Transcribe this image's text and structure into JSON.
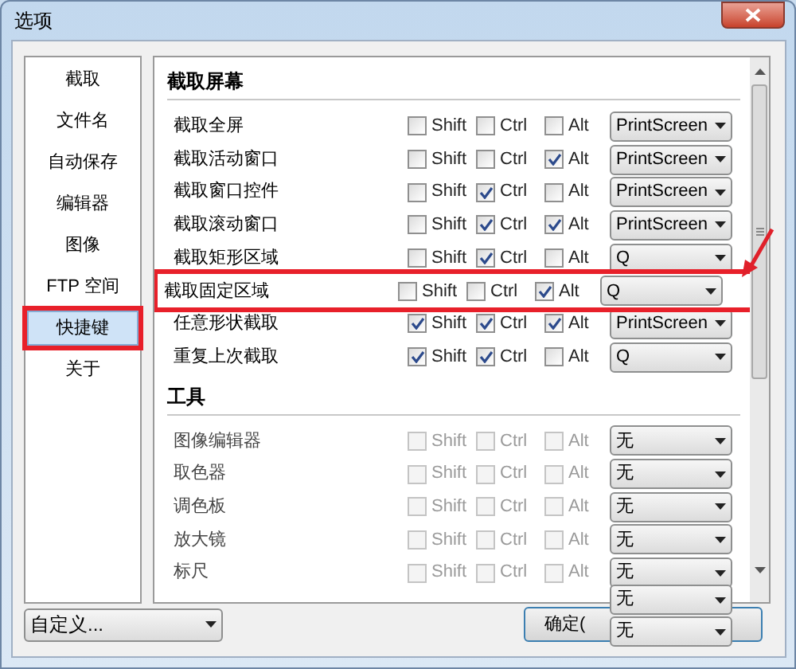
{
  "window": {
    "title": "选项"
  },
  "sidebar": {
    "items": [
      {
        "label": "截取",
        "selected": false,
        "highlighted": false
      },
      {
        "label": "文件名",
        "selected": false,
        "highlighted": false
      },
      {
        "label": "自动保存",
        "selected": false,
        "highlighted": false
      },
      {
        "label": "编辑器",
        "selected": false,
        "highlighted": false
      },
      {
        "label": "图像",
        "selected": false,
        "highlighted": false
      },
      {
        "label": "FTP 空间",
        "selected": false,
        "highlighted": false
      },
      {
        "label": "快捷键",
        "selected": true,
        "highlighted": true
      },
      {
        "label": "关于",
        "selected": false,
        "highlighted": false
      }
    ]
  },
  "sections": [
    {
      "title": "截取屏幕",
      "rows": [
        {
          "label": "截取全屏",
          "disabled": false,
          "highlighted": false,
          "mods": [
            {
              "label": "Shift",
              "checked": false
            },
            {
              "label": "Ctrl",
              "checked": false
            },
            {
              "label": "Alt",
              "checked": false
            }
          ],
          "key": "PrintScreen"
        },
        {
          "label": "截取活动窗口",
          "disabled": false,
          "highlighted": false,
          "mods": [
            {
              "label": "Shift",
              "checked": false
            },
            {
              "label": "Ctrl",
              "checked": false
            },
            {
              "label": "Alt",
              "checked": true
            }
          ],
          "key": "PrintScreen"
        },
        {
          "label": "截取窗口控件",
          "disabled": false,
          "highlighted": false,
          "mods": [
            {
              "label": "Shift",
              "checked": false
            },
            {
              "label": "Ctrl",
              "checked": true
            },
            {
              "label": "Alt",
              "checked": false
            }
          ],
          "key": "PrintScreen"
        },
        {
          "label": "截取滚动窗口",
          "disabled": false,
          "highlighted": false,
          "mods": [
            {
              "label": "Shift",
              "checked": false
            },
            {
              "label": "Ctrl",
              "checked": true
            },
            {
              "label": "Alt",
              "checked": true
            }
          ],
          "key": "PrintScreen"
        },
        {
          "label": "截取矩形区域",
          "disabled": false,
          "highlighted": false,
          "mods": [
            {
              "label": "Shift",
              "checked": false
            },
            {
              "label": "Ctrl",
              "checked": true
            },
            {
              "label": "Alt",
              "checked": false
            }
          ],
          "key": "Q"
        },
        {
          "label": "截取固定区域",
          "disabled": false,
          "highlighted": true,
          "mods": [
            {
              "label": "Shift",
              "checked": false
            },
            {
              "label": "Ctrl",
              "checked": false
            },
            {
              "label": "Alt",
              "checked": true
            }
          ],
          "key": "Q"
        },
        {
          "label": "任意形状截取",
          "disabled": false,
          "highlighted": false,
          "mods": [
            {
              "label": "Shift",
              "checked": true
            },
            {
              "label": "Ctrl",
              "checked": true
            },
            {
              "label": "Alt",
              "checked": true
            }
          ],
          "key": "PrintScreen"
        },
        {
          "label": "重复上次截取",
          "disabled": false,
          "highlighted": false,
          "mods": [
            {
              "label": "Shift",
              "checked": true
            },
            {
              "label": "Ctrl",
              "checked": true
            },
            {
              "label": "Alt",
              "checked": false
            }
          ],
          "key": "Q"
        }
      ]
    },
    {
      "title": "工具",
      "rows": [
        {
          "label": "图像编辑器",
          "disabled": true,
          "highlighted": false,
          "mods": [
            {
              "label": "Shift",
              "checked": false
            },
            {
              "label": "Ctrl",
              "checked": false
            },
            {
              "label": "Alt",
              "checked": false
            }
          ],
          "key": "无"
        },
        {
          "label": "取色器",
          "disabled": true,
          "highlighted": false,
          "mods": [
            {
              "label": "Shift",
              "checked": false
            },
            {
              "label": "Ctrl",
              "checked": false
            },
            {
              "label": "Alt",
              "checked": false
            }
          ],
          "key": "无"
        },
        {
          "label": "调色板",
          "disabled": true,
          "highlighted": false,
          "mods": [
            {
              "label": "Shift",
              "checked": false
            },
            {
              "label": "Ctrl",
              "checked": false
            },
            {
              "label": "Alt",
              "checked": false
            }
          ],
          "key": "无"
        },
        {
          "label": "放大镜",
          "disabled": true,
          "highlighted": false,
          "mods": [
            {
              "label": "Shift",
              "checked": false
            },
            {
              "label": "Ctrl",
              "checked": false
            },
            {
              "label": "Alt",
              "checked": false
            }
          ],
          "key": "无"
        },
        {
          "label": "标尺",
          "disabled": true,
          "highlighted": false,
          "mods": [
            {
              "label": "Shift",
              "checked": false
            },
            {
              "label": "Ctrl",
              "checked": false
            },
            {
              "label": "Alt",
              "checked": false
            }
          ],
          "key": "无"
        }
      ]
    }
  ],
  "floating_dropdowns": [
    {
      "value": "无"
    },
    {
      "value": "无"
    }
  ],
  "footer": {
    "profile": "自定义...",
    "ok_button": "确定("
  }
}
